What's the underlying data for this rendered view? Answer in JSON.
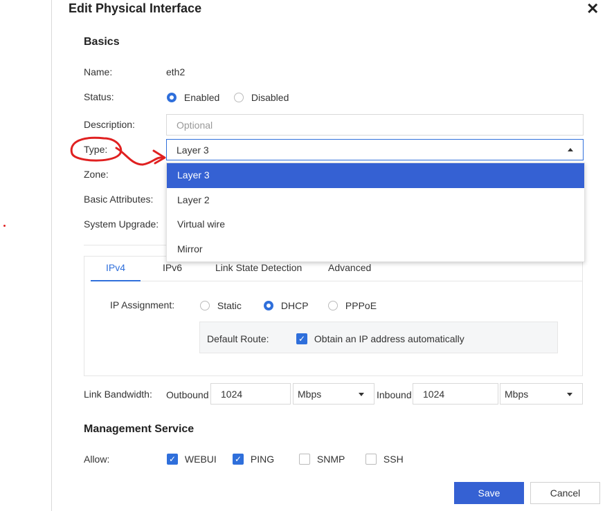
{
  "dialog": {
    "title": "Edit Physical Interface"
  },
  "basics": {
    "heading": "Basics",
    "name_label": "Name:",
    "name_value": "eth2",
    "status_label": "Status:",
    "status_enabled": "Enabled",
    "status_disabled": "Disabled",
    "description_label": "Description:",
    "description_placeholder": "Optional",
    "type_label": "Type:",
    "type_value": "Layer 3",
    "type_options": [
      "Layer 3",
      "Layer 2",
      "Virtual wire",
      "Mirror"
    ],
    "zone_label": "Zone:",
    "basic_attributes_label": "Basic Attributes:",
    "system_upgrade_label": "System Upgrade:"
  },
  "tabs": [
    "IPv4",
    "IPv6",
    "Link State Detection",
    "Advanced"
  ],
  "ipv4": {
    "ip_assignment_label": "IP Assignment:",
    "options": [
      "Static",
      "DHCP",
      "PPPoE"
    ],
    "selected": "DHCP",
    "default_route_label": "Default Route:",
    "obtain_auto_label": "Obtain an IP address automatically"
  },
  "bandwidth": {
    "label": "Link Bandwidth:",
    "outbound_label": "Outbound",
    "outbound_value": "1024",
    "outbound_unit": "Mbps",
    "inbound_label": "Inbound",
    "inbound_value": "1024",
    "inbound_unit": "Mbps"
  },
  "management": {
    "heading": "Management Service",
    "allow_label": "Allow:",
    "webui": "WEBUI",
    "ping": "PING",
    "snmp": "SNMP",
    "ssh": "SSH"
  },
  "buttons": {
    "save": "Save",
    "cancel": "Cancel"
  },
  "annotation": {
    "color": "#e02020"
  },
  "colors": {
    "accent": "#3561d3"
  }
}
